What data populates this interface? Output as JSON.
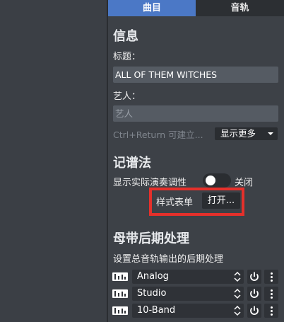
{
  "tabs": [
    {
      "label": "曲目",
      "active": true
    },
    {
      "label": "音轨",
      "active": false
    }
  ],
  "info": {
    "title": "信息",
    "title_label": "标题：",
    "title_value": "ALL OF THEM WITCHES",
    "artist_label": "艺人：",
    "artist_placeholder": "艺人",
    "hint": "Ctrl+Return 可建立...",
    "show_more": "显示更多"
  },
  "notation": {
    "title": "记谱法",
    "concert_pitch_label": "显示实际演奏调性",
    "toggle_state": "关闭",
    "toggle_on": false,
    "stylesheet_label": "样式表单",
    "open_button": "打开..."
  },
  "master": {
    "title": "母带后期处理",
    "description": "设置总音轨输出的后期处理",
    "effects": [
      {
        "name": "Analog",
        "icon": "equalizer-icon"
      },
      {
        "name": "Studio",
        "icon": "equalizer-icon"
      },
      {
        "name": "10-Band",
        "icon": "equalizer-icon"
      }
    ]
  },
  "colors": {
    "accent": "#4b78c6",
    "highlight": "#e5302b",
    "panel_bg": "#3d4147",
    "field_bg": "#555b63"
  }
}
